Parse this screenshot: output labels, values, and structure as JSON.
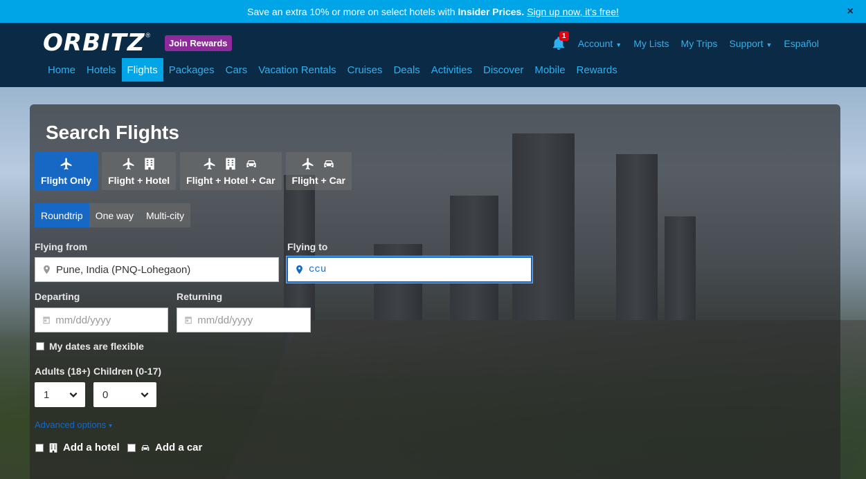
{
  "promo": {
    "text": "Save an extra 10% or more on select hotels with",
    "bold": "Insider Prices.",
    "link": "Sign up now, it's free!",
    "close": "×"
  },
  "header": {
    "logo": "ORBITZ",
    "logo_tm": "®",
    "join_rewards": "Join Rewards",
    "notification_count": "1",
    "account": "Account",
    "my_lists": "My Lists",
    "my_trips": "My Trips",
    "support": "Support",
    "language": "Español"
  },
  "nav": [
    "Home",
    "Hotels",
    "Flights",
    "Packages",
    "Cars",
    "Vacation Rentals",
    "Cruises",
    "Deals",
    "Activities",
    "Discover",
    "Mobile",
    "Rewards"
  ],
  "nav_active": "Flights",
  "search": {
    "title": "Search Flights",
    "product_tabs": [
      {
        "label": "Flight Only",
        "icons": [
          "plane-icon"
        ],
        "active": true
      },
      {
        "label": "Flight + Hotel",
        "icons": [
          "plane-icon",
          "hotel-icon"
        ],
        "active": false
      },
      {
        "label": "Flight + Hotel + Car",
        "icons": [
          "plane-icon",
          "hotel-icon",
          "car-icon"
        ],
        "active": false
      },
      {
        "label": "Flight + Car",
        "icons": [
          "plane-icon",
          "car-icon"
        ],
        "active": false
      }
    ],
    "trip_types": [
      "Roundtrip",
      "One way",
      "Multi-city"
    ],
    "trip_type_active": "Roundtrip",
    "flying_from_label": "Flying from",
    "flying_from_value": "Pune, India (PNQ-Lohegaon)",
    "flying_to_label": "Flying to",
    "flying_to_value": "ccu",
    "departing_label": "Departing",
    "departing_placeholder": "mm/dd/yyyy",
    "returning_label": "Returning",
    "returning_placeholder": "mm/dd/yyyy",
    "flexible_label": "My dates are flexible",
    "adults_label": "Adults (18+)",
    "adults_value": "1",
    "children_label": "Children (0-17)",
    "children_value": "0",
    "advanced_options": "Advanced options",
    "add_hotel": "Add a hotel",
    "add_car": "Add a car"
  },
  "colors": {
    "accent": "#00a5e8",
    "header_bg": "#0a2a45",
    "active_tab": "#1668c4",
    "rewards": "#8e2b9c",
    "badge": "#e2000f"
  }
}
